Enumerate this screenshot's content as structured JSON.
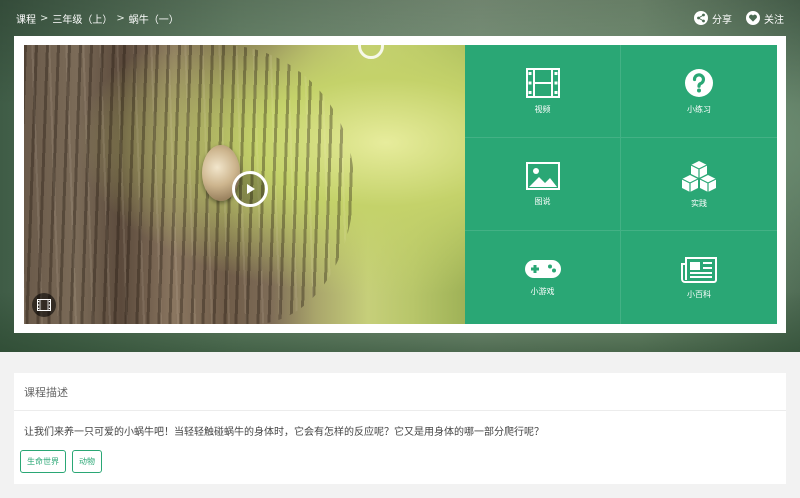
{
  "breadcrumb": {
    "items": [
      "课程",
      "三年级（上）",
      "蜗牛（一）"
    ],
    "separator": ">"
  },
  "actions": {
    "share_label": "分享",
    "follow_label": "关注"
  },
  "tiles": [
    {
      "label": "视频",
      "icon": "film-icon"
    },
    {
      "label": "小练习",
      "icon": "question-icon"
    },
    {
      "label": "图说",
      "icon": "image-icon"
    },
    {
      "label": "实践",
      "icon": "cubes-icon"
    },
    {
      "label": "小游戏",
      "icon": "gamepad-icon"
    },
    {
      "label": "小百科",
      "icon": "newspaper-icon"
    }
  ],
  "description": {
    "title": "课程描述",
    "text": "让我们来养一只可爱的小蜗牛吧！当轻轻触碰蜗牛的身体时，它会有怎样的反应呢？它又是用身体的哪一部分爬行呢？",
    "tags": [
      "生命世界",
      "动物"
    ]
  },
  "colors": {
    "accent": "#2aa775",
    "tile_bg": "#2aa775"
  }
}
